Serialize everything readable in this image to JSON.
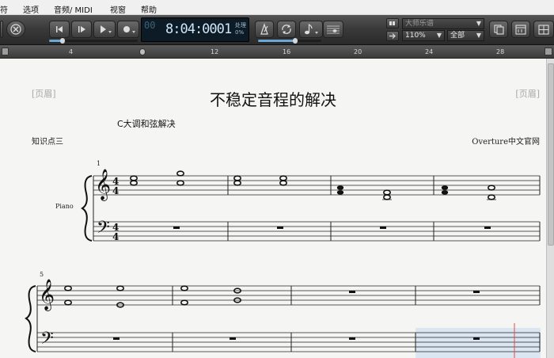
{
  "menu": [
    "符",
    "选项",
    "音频/ MIDI",
    "视窗",
    "帮助"
  ],
  "toolbar": {
    "lcd_counter": "00",
    "lcd_time": "8:04:000",
    "lcd_beat": "1",
    "lcd_status": "处理",
    "lcd_percent": "0%",
    "style_dropdown": "大师乐谱",
    "zoom_dropdown": "110%",
    "view_dropdown": "全部"
  },
  "ruler": [
    "4",
    "12",
    "16",
    "20",
    "24",
    "28"
  ],
  "score": {
    "header_left": "[页眉]",
    "header_right": "[页眉]",
    "title": "不稳定音程的解决",
    "subtitle": "C大调和弦解决",
    "left_note": "知识点三",
    "right_note": "Overture中文官网",
    "instrument": "Piano",
    "measure_1": "1",
    "measure_5": "5"
  }
}
